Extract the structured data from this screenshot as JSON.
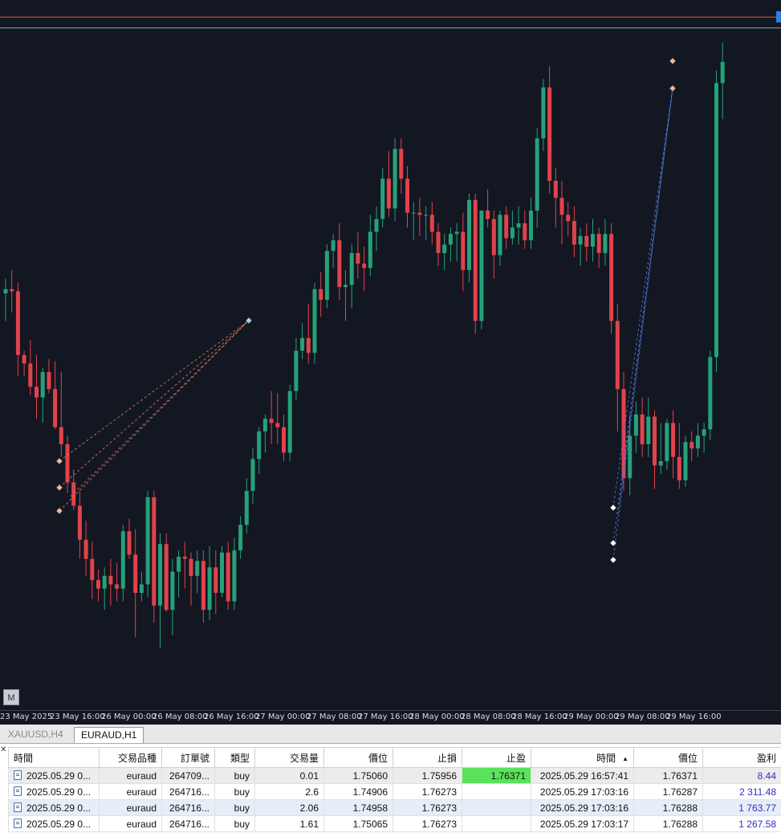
{
  "colors": {
    "chart_bg": "#131722",
    "bull": "#26a17a",
    "bear": "#e0434c",
    "tp_line": "#e05a50",
    "price_line": "#7fb3a8",
    "tp_highlight": "#5be25b",
    "profit_text": "#2d2dc8"
  },
  "chart": {
    "symbol": "EURAUD",
    "timeframe": "H1",
    "m_button_label": "M",
    "time_labels": [
      "23 May 2025",
      "23 May 16:00",
      "26 May 00:00",
      "26 May 08:00",
      "26 May 16:00",
      "27 May 00:00",
      "27 May 08:00",
      "27 May 16:00",
      "28 May 00:00",
      "28 May 08:00",
      "28 May 16:00",
      "29 May 00:00",
      "29 May 08:00",
      "29 May 16:00"
    ]
  },
  "chart_data": {
    "type": "candlestick",
    "title": "",
    "xlabel": "",
    "ylabel": "",
    "candles": [
      {
        "o": 1.7507,
        "h": 1.7514,
        "l": 1.7494,
        "c": 1.7509
      },
      {
        "o": 1.7509,
        "h": 1.7518,
        "l": 1.7498,
        "c": 1.7508
      },
      {
        "o": 1.7508,
        "h": 1.7512,
        "l": 1.7468,
        "c": 1.7478
      },
      {
        "o": 1.7478,
        "h": 1.748,
        "l": 1.7468,
        "c": 1.7474
      },
      {
        "o": 1.7474,
        "h": 1.7485,
        "l": 1.7459,
        "c": 1.7463
      },
      {
        "o": 1.7463,
        "h": 1.7478,
        "l": 1.7448,
        "c": 1.7458
      },
      {
        "o": 1.7458,
        "h": 1.7472,
        "l": 1.7446,
        "c": 1.747
      },
      {
        "o": 1.747,
        "h": 1.7476,
        "l": 1.746,
        "c": 1.7462
      },
      {
        "o": 1.7462,
        "h": 1.7475,
        "l": 1.7443,
        "c": 1.7444
      },
      {
        "o": 1.7444,
        "h": 1.747,
        "l": 1.743,
        "c": 1.7436
      },
      {
        "o": 1.7436,
        "h": 1.744,
        "l": 1.7413,
        "c": 1.7418
      },
      {
        "o": 1.7418,
        "h": 1.7424,
        "l": 1.7405,
        "c": 1.7407
      },
      {
        "o": 1.7407,
        "h": 1.7414,
        "l": 1.7382,
        "c": 1.7391
      },
      {
        "o": 1.7391,
        "h": 1.74,
        "l": 1.7374,
        "c": 1.7382
      },
      {
        "o": 1.7382,
        "h": 1.739,
        "l": 1.7363,
        "c": 1.7372
      },
      {
        "o": 1.7372,
        "h": 1.7377,
        "l": 1.7362,
        "c": 1.7368
      },
      {
        "o": 1.7368,
        "h": 1.7378,
        "l": 1.7358,
        "c": 1.7374
      },
      {
        "o": 1.7374,
        "h": 1.7382,
        "l": 1.736,
        "c": 1.737
      },
      {
        "o": 1.737,
        "h": 1.738,
        "l": 1.7362,
        "c": 1.7368
      },
      {
        "o": 1.7368,
        "h": 1.7398,
        "l": 1.7362,
        "c": 1.7395
      },
      {
        "o": 1.7395,
        "h": 1.7401,
        "l": 1.7382,
        "c": 1.7384
      },
      {
        "o": 1.7384,
        "h": 1.7396,
        "l": 1.7345,
        "c": 1.7366
      },
      {
        "o": 1.7366,
        "h": 1.7376,
        "l": 1.7362,
        "c": 1.737
      },
      {
        "o": 1.737,
        "h": 1.7414,
        "l": 1.7364,
        "c": 1.7411
      },
      {
        "o": 1.7411,
        "h": 1.7414,
        "l": 1.7352,
        "c": 1.736
      },
      {
        "o": 1.736,
        "h": 1.7394,
        "l": 1.734,
        "c": 1.7389
      },
      {
        "o": 1.7389,
        "h": 1.7394,
        "l": 1.7357,
        "c": 1.7358
      },
      {
        "o": 1.7358,
        "h": 1.7382,
        "l": 1.7346,
        "c": 1.7376
      },
      {
        "o": 1.7376,
        "h": 1.7386,
        "l": 1.7364,
        "c": 1.7383
      },
      {
        "o": 1.7383,
        "h": 1.739,
        "l": 1.7368,
        "c": 1.7382
      },
      {
        "o": 1.7382,
        "h": 1.7385,
        "l": 1.736,
        "c": 1.7374
      },
      {
        "o": 1.7374,
        "h": 1.7386,
        "l": 1.7366,
        "c": 1.7381
      },
      {
        "o": 1.7381,
        "h": 1.7386,
        "l": 1.7352,
        "c": 1.7358
      },
      {
        "o": 1.7358,
        "h": 1.7388,
        "l": 1.7353,
        "c": 1.7378
      },
      {
        "o": 1.7378,
        "h": 1.7386,
        "l": 1.7356,
        "c": 1.7366
      },
      {
        "o": 1.7366,
        "h": 1.7388,
        "l": 1.7364,
        "c": 1.7385
      },
      {
        "o": 1.7385,
        "h": 1.739,
        "l": 1.7358,
        "c": 1.7362
      },
      {
        "o": 1.7362,
        "h": 1.7392,
        "l": 1.7358,
        "c": 1.7386
      },
      {
        "o": 1.7386,
        "h": 1.7402,
        "l": 1.7382,
        "c": 1.7398
      },
      {
        "o": 1.7398,
        "h": 1.742,
        "l": 1.7394,
        "c": 1.7414
      },
      {
        "o": 1.7414,
        "h": 1.7434,
        "l": 1.7408,
        "c": 1.7429
      },
      {
        "o": 1.7429,
        "h": 1.7444,
        "l": 1.7422,
        "c": 1.7442
      },
      {
        "o": 1.7442,
        "h": 1.745,
        "l": 1.7432,
        "c": 1.7448
      },
      {
        "o": 1.7448,
        "h": 1.7461,
        "l": 1.7436,
        "c": 1.7446
      },
      {
        "o": 1.7446,
        "h": 1.746,
        "l": 1.7436,
        "c": 1.7444
      },
      {
        "o": 1.7444,
        "h": 1.745,
        "l": 1.7428,
        "c": 1.7432
      },
      {
        "o": 1.7432,
        "h": 1.7464,
        "l": 1.7428,
        "c": 1.7461
      },
      {
        "o": 1.7461,
        "h": 1.7486,
        "l": 1.7457,
        "c": 1.748
      },
      {
        "o": 1.748,
        "h": 1.7493,
        "l": 1.7476,
        "c": 1.7486
      },
      {
        "o": 1.7486,
        "h": 1.7502,
        "l": 1.7474,
        "c": 1.7479
      },
      {
        "o": 1.7479,
        "h": 1.7512,
        "l": 1.7474,
        "c": 1.7509
      },
      {
        "o": 1.7509,
        "h": 1.7517,
        "l": 1.7496,
        "c": 1.7504
      },
      {
        "o": 1.7504,
        "h": 1.753,
        "l": 1.75,
        "c": 1.7527
      },
      {
        "o": 1.7527,
        "h": 1.7535,
        "l": 1.7519,
        "c": 1.7532
      },
      {
        "o": 1.7532,
        "h": 1.754,
        "l": 1.7504,
        "c": 1.751
      },
      {
        "o": 1.751,
        "h": 1.7518,
        "l": 1.7494,
        "c": 1.7511
      },
      {
        "o": 1.7511,
        "h": 1.753,
        "l": 1.75,
        "c": 1.7526
      },
      {
        "o": 1.7526,
        "h": 1.7536,
        "l": 1.7514,
        "c": 1.7521
      },
      {
        "o": 1.7521,
        "h": 1.7529,
        "l": 1.7508,
        "c": 1.7519
      },
      {
        "o": 1.7519,
        "h": 1.7544,
        "l": 1.7515,
        "c": 1.7536
      },
      {
        "o": 1.7536,
        "h": 1.7548,
        "l": 1.7527,
        "c": 1.7542
      },
      {
        "o": 1.7542,
        "h": 1.7566,
        "l": 1.7538,
        "c": 1.7561
      },
      {
        "o": 1.7561,
        "h": 1.7574,
        "l": 1.7543,
        "c": 1.7547
      },
      {
        "o": 1.7547,
        "h": 1.758,
        "l": 1.7541,
        "c": 1.7575
      },
      {
        "o": 1.7575,
        "h": 1.758,
        "l": 1.7554,
        "c": 1.7561
      },
      {
        "o": 1.7561,
        "h": 1.7567,
        "l": 1.7538,
        "c": 1.7545
      },
      {
        "o": 1.7545,
        "h": 1.755,
        "l": 1.7532,
        "c": 1.7545
      },
      {
        "o": 1.7545,
        "h": 1.7552,
        "l": 1.7534,
        "c": 1.7544
      },
      {
        "o": 1.7544,
        "h": 1.7548,
        "l": 1.7532,
        "c": 1.7544
      },
      {
        "o": 1.7544,
        "h": 1.755,
        "l": 1.753,
        "c": 1.7536
      },
      {
        "o": 1.7536,
        "h": 1.754,
        "l": 1.752,
        "c": 1.7526
      },
      {
        "o": 1.7526,
        "h": 1.7535,
        "l": 1.7518,
        "c": 1.753
      },
      {
        "o": 1.753,
        "h": 1.7538,
        "l": 1.7522,
        "c": 1.7535
      },
      {
        "o": 1.7535,
        "h": 1.754,
        "l": 1.7522,
        "c": 1.7536
      },
      {
        "o": 1.7536,
        "h": 1.7545,
        "l": 1.7508,
        "c": 1.7518
      },
      {
        "o": 1.7518,
        "h": 1.7554,
        "l": 1.7512,
        "c": 1.7551
      },
      {
        "o": 1.7551,
        "h": 1.7554,
        "l": 1.7488,
        "c": 1.7494
      },
      {
        "o": 1.7494,
        "h": 1.752,
        "l": 1.749,
        "c": 1.7546
      },
      {
        "o": 1.7546,
        "h": 1.7556,
        "l": 1.7538,
        "c": 1.7542
      },
      {
        "o": 1.7542,
        "h": 1.7546,
        "l": 1.7514,
        "c": 1.7525
      },
      {
        "o": 1.7525,
        "h": 1.7546,
        "l": 1.752,
        "c": 1.7544
      },
      {
        "o": 1.7544,
        "h": 1.7548,
        "l": 1.7528,
        "c": 1.7533
      },
      {
        "o": 1.7533,
        "h": 1.7546,
        "l": 1.753,
        "c": 1.7538
      },
      {
        "o": 1.7538,
        "h": 1.7548,
        "l": 1.753,
        "c": 1.754
      },
      {
        "o": 1.754,
        "h": 1.7546,
        "l": 1.7528,
        "c": 1.7532
      },
      {
        "o": 1.7532,
        "h": 1.7552,
        "l": 1.7528,
        "c": 1.7546
      },
      {
        "o": 1.7546,
        "h": 1.7585,
        "l": 1.7538,
        "c": 1.758
      },
      {
        "o": 1.758,
        "h": 1.7608,
        "l": 1.7574,
        "c": 1.7604
      },
      {
        "o": 1.7604,
        "h": 1.7614,
        "l": 1.7554,
        "c": 1.756
      },
      {
        "o": 1.756,
        "h": 1.7566,
        "l": 1.7538,
        "c": 1.7552
      },
      {
        "o": 1.7552,
        "h": 1.756,
        "l": 1.753,
        "c": 1.7544
      },
      {
        "o": 1.7544,
        "h": 1.755,
        "l": 1.7534,
        "c": 1.7541
      },
      {
        "o": 1.7541,
        "h": 1.7548,
        "l": 1.7524,
        "c": 1.753
      },
      {
        "o": 1.753,
        "h": 1.7538,
        "l": 1.752,
        "c": 1.7534
      },
      {
        "o": 1.7534,
        "h": 1.754,
        "l": 1.7522,
        "c": 1.7529
      },
      {
        "o": 1.7529,
        "h": 1.7542,
        "l": 1.7522,
        "c": 1.7535
      },
      {
        "o": 1.7535,
        "h": 1.7538,
        "l": 1.7519,
        "c": 1.7526
      },
      {
        "o": 1.7526,
        "h": 1.7542,
        "l": 1.752,
        "c": 1.7535
      },
      {
        "o": 1.7535,
        "h": 1.754,
        "l": 1.7488,
        "c": 1.7494
      },
      {
        "o": 1.7494,
        "h": 1.7502,
        "l": 1.7442,
        "c": 1.7462
      },
      {
        "o": 1.7462,
        "h": 1.747,
        "l": 1.7414,
        "c": 1.742
      },
      {
        "o": 1.742,
        "h": 1.745,
        "l": 1.7412,
        "c": 1.744
      },
      {
        "o": 1.744,
        "h": 1.7456,
        "l": 1.7432,
        "c": 1.745
      },
      {
        "o": 1.745,
        "h": 1.7458,
        "l": 1.743,
        "c": 1.7436
      },
      {
        "o": 1.7436,
        "h": 1.7458,
        "l": 1.743,
        "c": 1.7449
      },
      {
        "o": 1.7449,
        "h": 1.7452,
        "l": 1.7415,
        "c": 1.7426
      },
      {
        "o": 1.7426,
        "h": 1.7446,
        "l": 1.7422,
        "c": 1.7428
      },
      {
        "o": 1.7428,
        "h": 1.7448,
        "l": 1.7424,
        "c": 1.7446
      },
      {
        "o": 1.7446,
        "h": 1.7452,
        "l": 1.742,
        "c": 1.743
      },
      {
        "o": 1.743,
        "h": 1.7446,
        "l": 1.7415,
        "c": 1.7419
      },
      {
        "o": 1.7419,
        "h": 1.744,
        "l": 1.7416,
        "c": 1.7437
      },
      {
        "o": 1.7437,
        "h": 1.7442,
        "l": 1.7428,
        "c": 1.7434
      },
      {
        "o": 1.7434,
        "h": 1.7446,
        "l": 1.743,
        "c": 1.744
      },
      {
        "o": 1.744,
        "h": 1.7446,
        "l": 1.7432,
        "c": 1.7443
      },
      {
        "o": 1.7443,
        "h": 1.748,
        "l": 1.7438,
        "c": 1.7477
      },
      {
        "o": 1.7477,
        "h": 1.7612,
        "l": 1.747,
        "c": 1.7606
      },
      {
        "o": 1.7606,
        "h": 1.7625,
        "l": 1.7589,
        "c": 1.7616
      }
    ],
    "horizontal_lines": [
      {
        "name": "take-profit",
        "price": 1.76371
      },
      {
        "name": "current-price",
        "price": 1.7635
      }
    ]
  },
  "tabs": [
    {
      "label": "XAUUSD,H4",
      "active": false
    },
    {
      "label": "EURAUD,H1",
      "active": true
    }
  ],
  "table": {
    "headers": [
      "時間",
      "交易品種",
      "訂單號",
      "類型",
      "交易量",
      "價位",
      "止損",
      "止盈",
      "時間",
      "價位",
      "盈利"
    ],
    "rows": [
      {
        "open_time": "2025.05.29 0...",
        "symbol": "euraud",
        "order": "264709...",
        "type": "buy",
        "volume": "0.01",
        "open_price": "1.75060",
        "sl": "1.75956",
        "tp": "1.76371",
        "time": "2025.05.29 16:57:41",
        "price": "1.76371",
        "profit": "8.44"
      },
      {
        "open_time": "2025.05.29 0...",
        "symbol": "euraud",
        "order": "264716...",
        "type": "buy",
        "volume": "2.6",
        "open_price": "1.74906",
        "sl": "1.76273",
        "tp": "",
        "time": "2025.05.29 17:03:16",
        "price": "1.76287",
        "profit": "2 311.48"
      },
      {
        "open_time": "2025.05.29 0...",
        "symbol": "euraud",
        "order": "264716...",
        "type": "buy",
        "volume": "2.06",
        "open_price": "1.74958",
        "sl": "1.76273",
        "tp": "",
        "time": "2025.05.29 17:03:16",
        "price": "1.76288",
        "profit": "1 763.77"
      },
      {
        "open_time": "2025.05.29 0...",
        "symbol": "euraud",
        "order": "264716...",
        "type": "buy",
        "volume": "1.61",
        "open_price": "1.75065",
        "sl": "1.76273",
        "tp": "",
        "time": "2025.05.29 17:03:17",
        "price": "1.76288",
        "profit": "1 267.58"
      }
    ]
  }
}
